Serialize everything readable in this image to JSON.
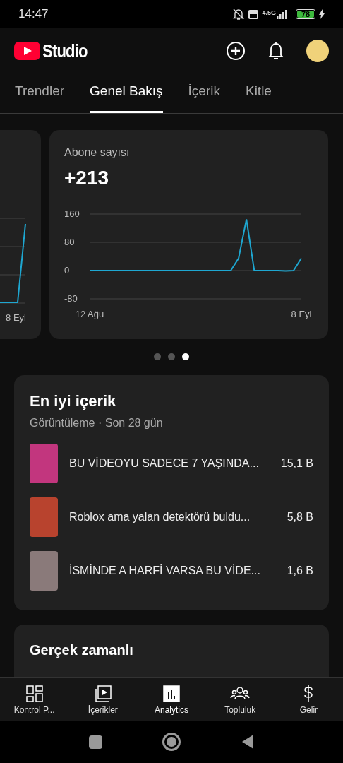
{
  "status_bar": {
    "time": "14:47",
    "network": "4.5G",
    "battery": "78"
  },
  "header": {
    "logo_text": "Studio"
  },
  "tabs": [
    {
      "label": "Trendler",
      "selected": false
    },
    {
      "label": "Genel Bakış",
      "selected": true
    },
    {
      "label": "İçerik",
      "selected": false
    },
    {
      "label": "Kitle",
      "selected": false
    }
  ],
  "partial_card": {
    "x_label": "8 Eyl"
  },
  "metric_card": {
    "title": "Abone sayısı",
    "value": "+213",
    "chart_data": {
      "type": "line",
      "categories": [
        "12 Ağu",
        null,
        null,
        null,
        null,
        null,
        null,
        null,
        null,
        null,
        null,
        null,
        null,
        null,
        null,
        null,
        null,
        null,
        null,
        null,
        null,
        null,
        null,
        null,
        null,
        null,
        null,
        "8 Eyl"
      ],
      "series": [
        {
          "color": "#1ea7d1",
          "values": [
            0,
            0,
            0,
            0,
            0,
            0,
            0,
            0,
            0,
            0,
            0,
            0,
            0,
            0,
            0,
            0,
            0,
            0,
            0,
            35,
            145,
            0,
            0,
            0,
            0,
            -1,
            0,
            35
          ]
        }
      ],
      "ylim": [
        -80,
        160
      ],
      "yticks": [
        -80,
        0,
        80,
        160
      ]
    }
  },
  "carousel_dots": [
    {
      "selected": false
    },
    {
      "selected": false
    },
    {
      "selected": true
    }
  ],
  "top_content": {
    "title": "En iyi içerik",
    "subtitle": "Görüntüleme · Son 28 gün",
    "items": [
      {
        "title": "BU VİDEOYU SADECE 7 YAŞINDA...",
        "views": "15,1 B",
        "color": "#c2367e"
      },
      {
        "title": "Roblox ama yalan detektörü buldu...",
        "views": "5,8 B",
        "color": "#b8432e"
      },
      {
        "title": "İSMİNDE A HARFİ VARSA BU VİDE...",
        "views": "1,6 B",
        "color": "#8a7a7a"
      }
    ]
  },
  "realtime": {
    "title": "Gerçek zamanlı"
  },
  "bottom_nav": [
    {
      "label": "Kontrol P...",
      "kind": "dashboard",
      "selected": false
    },
    {
      "label": "İçerikler",
      "kind": "content",
      "selected": false
    },
    {
      "label": "Analytics",
      "kind": "analytics",
      "selected": true
    },
    {
      "label": "Topluluk",
      "kind": "community",
      "selected": false
    },
    {
      "label": "Gelir",
      "kind": "earn",
      "selected": false
    }
  ]
}
